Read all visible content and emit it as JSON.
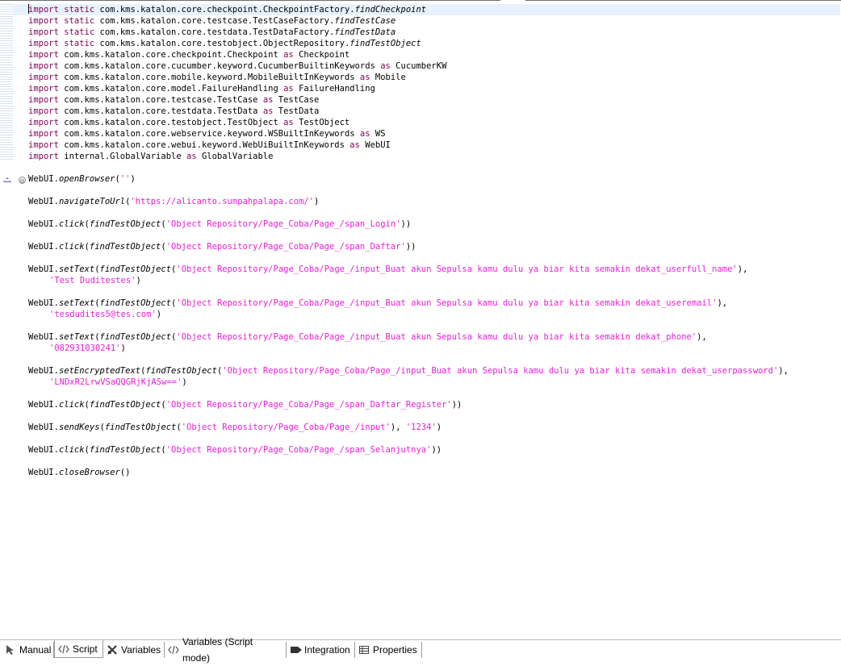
{
  "editor": {
    "lines": [
      [
        {
          "t": "import ",
          "c": "kw"
        },
        {
          "t": "static ",
          "c": "kw"
        },
        {
          "t": "com.kms.katalon.core.checkpoint.CheckpointFactory."
        },
        {
          "t": "findCheckpoint",
          "c": "it"
        }
      ],
      [
        {
          "t": "import ",
          "c": "kw"
        },
        {
          "t": "static ",
          "c": "kw"
        },
        {
          "t": "com.kms.katalon.core.testcase.TestCaseFactory."
        },
        {
          "t": "findTestCase",
          "c": "it"
        }
      ],
      [
        {
          "t": "import ",
          "c": "kw"
        },
        {
          "t": "static ",
          "c": "kw"
        },
        {
          "t": "com.kms.katalon.core.testdata.TestDataFactory."
        },
        {
          "t": "findTestData",
          "c": "it"
        }
      ],
      [
        {
          "t": "import ",
          "c": "kw"
        },
        {
          "t": "static ",
          "c": "kw"
        },
        {
          "t": "com.kms.katalon.core.testobject.ObjectRepository."
        },
        {
          "t": "findTestObject",
          "c": "it"
        }
      ],
      [
        {
          "t": "import ",
          "c": "kw"
        },
        {
          "t": "com.kms.katalon.core.checkpoint.Checkpoint "
        },
        {
          "t": "as ",
          "c": "kw"
        },
        {
          "t": "Checkpoint"
        }
      ],
      [
        {
          "t": "import ",
          "c": "kw"
        },
        {
          "t": "com.kms.katalon.core.cucumber.keyword.CucumberBuiltinKeywords "
        },
        {
          "t": "as ",
          "c": "kw"
        },
        {
          "t": "CucumberKW"
        }
      ],
      [
        {
          "t": "import ",
          "c": "kw"
        },
        {
          "t": "com.kms.katalon.core.mobile.keyword.MobileBuiltInKeywords "
        },
        {
          "t": "as ",
          "c": "kw"
        },
        {
          "t": "Mobile"
        }
      ],
      [
        {
          "t": "import ",
          "c": "kw"
        },
        {
          "t": "com.kms.katalon.core.model.FailureHandling "
        },
        {
          "t": "as ",
          "c": "kw"
        },
        {
          "t": "FailureHandling"
        }
      ],
      [
        {
          "t": "import ",
          "c": "kw"
        },
        {
          "t": "com.kms.katalon.core.testcase.TestCase "
        },
        {
          "t": "as ",
          "c": "kw"
        },
        {
          "t": "TestCase"
        }
      ],
      [
        {
          "t": "import ",
          "c": "kw"
        },
        {
          "t": "com.kms.katalon.core.testdata.TestData "
        },
        {
          "t": "as ",
          "c": "kw"
        },
        {
          "t": "TestData"
        }
      ],
      [
        {
          "t": "import ",
          "c": "kw"
        },
        {
          "t": "com.kms.katalon.core.testobject.TestObject "
        },
        {
          "t": "as ",
          "c": "kw"
        },
        {
          "t": "TestObject"
        }
      ],
      [
        {
          "t": "import ",
          "c": "kw"
        },
        {
          "t": "com.kms.katalon.core.webservice.keyword.WSBuiltInKeywords "
        },
        {
          "t": "as ",
          "c": "kw"
        },
        {
          "t": "WS"
        }
      ],
      [
        {
          "t": "import ",
          "c": "kw"
        },
        {
          "t": "com.kms.katalon.core.webui.keyword.WebUiBuiltInKeywords "
        },
        {
          "t": "as ",
          "c": "kw"
        },
        {
          "t": "WebUI"
        }
      ],
      [
        {
          "t": "import ",
          "c": "kw"
        },
        {
          "t": "internal.GlobalVariable "
        },
        {
          "t": "as ",
          "c": "kw"
        },
        {
          "t": "GlobalVariable"
        }
      ],
      [],
      [
        {
          "t": "WebUI."
        },
        {
          "t": "openBrowser",
          "c": "it"
        },
        {
          "t": "("
        },
        {
          "t": "''",
          "c": "str"
        },
        {
          "t": ")"
        }
      ],
      [],
      [
        {
          "t": "WebUI."
        },
        {
          "t": "navigateToUrl",
          "c": "it"
        },
        {
          "t": "("
        },
        {
          "t": "'https://alicanto.sumpahpalapa.com/'",
          "c": "str"
        },
        {
          "t": ")"
        }
      ],
      [],
      [
        {
          "t": "WebUI."
        },
        {
          "t": "click",
          "c": "it"
        },
        {
          "t": "("
        },
        {
          "t": "findTestObject",
          "c": "it"
        },
        {
          "t": "("
        },
        {
          "t": "'Object Repository/Page_Coba/Page_/span_Login'",
          "c": "str"
        },
        {
          "t": "))"
        }
      ],
      [],
      [
        {
          "t": "WebUI."
        },
        {
          "t": "click",
          "c": "it"
        },
        {
          "t": "("
        },
        {
          "t": "findTestObject",
          "c": "it"
        },
        {
          "t": "("
        },
        {
          "t": "'Object Repository/Page_Coba/Page_/span_Daftar'",
          "c": "str"
        },
        {
          "t": "))"
        }
      ],
      [],
      [
        {
          "t": "WebUI."
        },
        {
          "t": "setText",
          "c": "it"
        },
        {
          "t": "("
        },
        {
          "t": "findTestObject",
          "c": "it"
        },
        {
          "t": "("
        },
        {
          "t": "'Object Repository/Page_Coba/Page_/input_Buat akun Sepulsa kamu dulu ya biar kita semakin dekat_userfull_name'",
          "c": "str"
        },
        {
          "t": "),"
        }
      ],
      [
        {
          "t": "'Test Duditestes'",
          "c": "str"
        },
        {
          "t": ")"
        }
      ],
      [],
      [
        {
          "t": "WebUI."
        },
        {
          "t": "setText",
          "c": "it"
        },
        {
          "t": "("
        },
        {
          "t": "findTestObject",
          "c": "it"
        },
        {
          "t": "("
        },
        {
          "t": "'Object Repository/Page_Coba/Page_/input_Buat akun Sepulsa kamu dulu ya biar kita semakin dekat_useremail'",
          "c": "str"
        },
        {
          "t": "),"
        }
      ],
      [
        {
          "t": "'tesdudites5@tes.com'",
          "c": "str"
        },
        {
          "t": ")"
        }
      ],
      [],
      [
        {
          "t": "WebUI."
        },
        {
          "t": "setText",
          "c": "it"
        },
        {
          "t": "("
        },
        {
          "t": "findTestObject",
          "c": "it"
        },
        {
          "t": "("
        },
        {
          "t": "'Object Repository/Page_Coba/Page_/input_Buat akun Sepulsa kamu dulu ya biar kita semakin dekat_phone'",
          "c": "str"
        },
        {
          "t": "),"
        }
      ],
      [
        {
          "t": "'082931030241'",
          "c": "str"
        },
        {
          "t": ")"
        }
      ],
      [],
      [
        {
          "t": "WebUI."
        },
        {
          "t": "setEncryptedText",
          "c": "it"
        },
        {
          "t": "("
        },
        {
          "t": "findTestObject",
          "c": "it"
        },
        {
          "t": "("
        },
        {
          "t": "'Object Repository/Page_Coba/Page_/input_Buat akun Sepulsa kamu dulu ya biar kita semakin dekat_userpassword'",
          "c": "str"
        },
        {
          "t": "),"
        }
      ],
      [
        {
          "t": "'LNDxR2LrwVSaQQGRjKjASw=='",
          "c": "str"
        },
        {
          "t": ")"
        }
      ],
      [],
      [
        {
          "t": "WebUI."
        },
        {
          "t": "click",
          "c": "it"
        },
        {
          "t": "("
        },
        {
          "t": "findTestObject",
          "c": "it"
        },
        {
          "t": "("
        },
        {
          "t": "'Object Repository/Page_Coba/Page_/span_Daftar_Register'",
          "c": "str"
        },
        {
          "t": "))"
        }
      ],
      [],
      [
        {
          "t": "WebUI."
        },
        {
          "t": "sendKeys",
          "c": "it"
        },
        {
          "t": "("
        },
        {
          "t": "findTestObject",
          "c": "it"
        },
        {
          "t": "("
        },
        {
          "t": "'Object Repository/Page_Coba/Page_/input'",
          "c": "str"
        },
        {
          "t": "), "
        },
        {
          "t": "'1234'",
          "c": "str"
        },
        {
          "t": ")"
        }
      ],
      [],
      [
        {
          "t": "WebUI."
        },
        {
          "t": "click",
          "c": "it"
        },
        {
          "t": "("
        },
        {
          "t": "findTestObject",
          "c": "it"
        },
        {
          "t": "("
        },
        {
          "t": "'Object Repository/Page_Coba/Page_/span_Selanjutnya'",
          "c": "str"
        },
        {
          "t": "))"
        }
      ],
      [],
      [
        {
          "t": "WebUI."
        },
        {
          "t": "closeBrowser",
          "c": "it"
        },
        {
          "t": "()"
        }
      ]
    ],
    "fold_markers": {
      "collapse": "⊖"
    },
    "colors": {
      "keyword": "#7f0055",
      "string": "#e61fd6",
      "current_line": "#e8f2fe",
      "warning_marker": "#6b4fc9"
    }
  },
  "tabs": [
    {
      "label": "Manual",
      "icon": "cursor-icon"
    },
    {
      "label": "Script",
      "icon": "code-icon",
      "active": true
    },
    {
      "label": "Variables",
      "icon": "variables-icon"
    },
    {
      "label": "Variables (Script mode)",
      "icon": "code-icon"
    },
    {
      "label": "Integration",
      "icon": "integration-icon"
    },
    {
      "label": "Properties",
      "icon": "table-icon"
    }
  ]
}
